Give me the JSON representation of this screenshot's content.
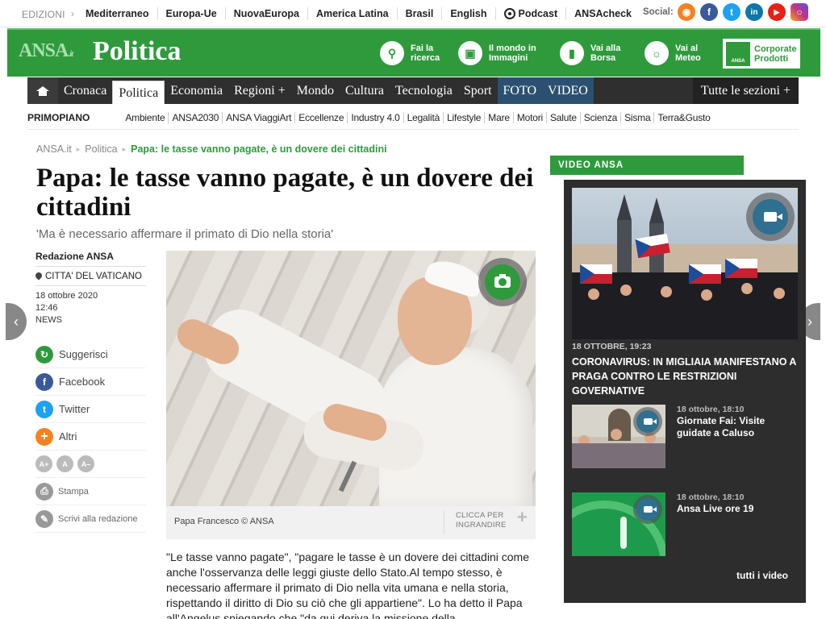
{
  "topbar": {
    "editions_label": "EDIZIONI",
    "editions": [
      "Mediterraneo",
      "Europa-Ue",
      "NuovaEuropa",
      "America Latina",
      "Brasil",
      "English"
    ],
    "podcast": "Podcast",
    "ansacheck": "ANSAcheck",
    "social_label": "Social:",
    "socials": [
      {
        "name": "rss",
        "glyph": "◉",
        "color": "#f58220"
      },
      {
        "name": "facebook",
        "glyph": "f",
        "color": "#3b5998"
      },
      {
        "name": "twitter",
        "glyph": "t",
        "color": "#1da1f2"
      },
      {
        "name": "linkedin",
        "glyph": "in",
        "color": "#0e76a8"
      },
      {
        "name": "youtube",
        "glyph": "▶",
        "color": "#e62117"
      },
      {
        "name": "instagram",
        "glyph": "○",
        "color": "#c13584"
      }
    ]
  },
  "header": {
    "logo": "ANSA",
    "logo_suffix": ".it",
    "section": "Politica",
    "buttons": [
      {
        "line1": "Fai la",
        "line2": "ricerca",
        "icon": "search-icon"
      },
      {
        "line1": "Il mondo in",
        "line2": "Immagini",
        "icon": "monitor-icon"
      },
      {
        "line1": "Vai alla",
        "line2": "Borsa",
        "icon": "chart-icon"
      },
      {
        "line1": "Vai al",
        "line2": "Meteo",
        "icon": "weather-icon"
      }
    ],
    "corporate_line1": "Corporate",
    "corporate_line2": "Prodotti",
    "corporate_mini": "ANSA"
  },
  "nav": {
    "items": [
      "Cronaca",
      "Politica",
      "Economia",
      "Regioni +",
      "Mondo",
      "Cultura",
      "Tecnologia",
      "Sport"
    ],
    "media": [
      "FOTO",
      "VIDEO"
    ],
    "all": "Tutte le sezioni +",
    "active": "Politica"
  },
  "subnav": {
    "lead": "PRIMOPIANO",
    "items": [
      "Ambiente",
      "ANSA2030",
      "ANSA ViaggiArt",
      "Eccellenze",
      "Industry 4.0",
      "Legalità",
      "Lifestyle",
      "Mare",
      "Motori",
      "Salute",
      "Scienza",
      "Sisma",
      "Terra&Gusto"
    ]
  },
  "breadcrumb": {
    "home": "ANSA.it",
    "section": "Politica",
    "current": "Papa: le tasse vanno pagate, è un dovere dei cittadini"
  },
  "article": {
    "title": "Papa: le tasse vanno pagate, è un dovere dei cittadini",
    "subtitle": "'Ma è necessario affermare il primato di Dio nella storia'",
    "author": "Redazione ANSA",
    "place": "CITTA' DEL VATICANO",
    "date": "18 ottobre 2020",
    "time": "12:46",
    "category": "NEWS",
    "caption": "Papa Francesco © ANSA",
    "zoom_line1": "CLICCA PER",
    "zoom_line2": "INGRANDIRE",
    "body": " \"Le tasse vanno pagate\", \"pagare le tasse è un dovere dei cittadini come anche l'osservanza delle leggi giuste dello Stato.Al tempo stesso, è necessario affermare il primato di Dio nella vita umana e nella storia, rispettando il diritto di Dio su ciò che gli appartiene\". Lo ha detto il Papa all'Angelus spiegando che \"da qui deriva la missione della"
  },
  "share": [
    {
      "label": "Suggerisci",
      "color": "#2f9a3c",
      "glyph": "↻",
      "icon": "suggest-icon"
    },
    {
      "label": "Facebook",
      "color": "#3b5998",
      "glyph": "f",
      "icon": "facebook-icon"
    },
    {
      "label": "Twitter",
      "color": "#1da1f2",
      "glyph": "t",
      "icon": "twitter-icon"
    },
    {
      "label": "Altri",
      "color": "#f58220",
      "glyph": "+",
      "icon": "plus-icon"
    }
  ],
  "fontsize": [
    "A+",
    "A",
    "A–"
  ],
  "tools": [
    {
      "label": "Stampa",
      "glyph": "⎙",
      "icon": "print-icon"
    },
    {
      "label": "Scrivi alla redazione",
      "glyph": "✎",
      "icon": "pencil-icon"
    }
  ],
  "video": {
    "label": "VIDEO ANSA",
    "main_date": "18 OTTOBRE, 19:23",
    "main_title": "CORONAVIRUS: IN MIGLIAIA MANIFESTANO A PRAGA CONTRO LE RESTRIZIONI GOVERNATIVE",
    "items": [
      {
        "date": "18 ottobre, 18:10",
        "title": "Giornate Fai: Visite guidate a Caluso"
      },
      {
        "date": "18 ottobre, 18:10",
        "title": "Ansa Live ore 19"
      }
    ],
    "all": "tutti i video"
  }
}
